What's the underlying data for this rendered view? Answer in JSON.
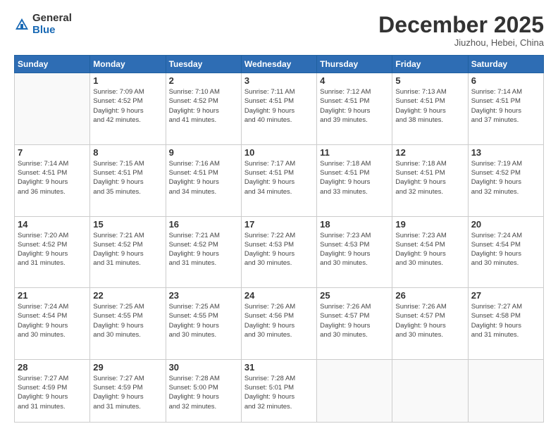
{
  "logo": {
    "general": "General",
    "blue": "Blue"
  },
  "title": "December 2025",
  "subtitle": "Jiuzhou, Hebei, China",
  "days_of_week": [
    "Sunday",
    "Monday",
    "Tuesday",
    "Wednesday",
    "Thursday",
    "Friday",
    "Saturday"
  ],
  "weeks": [
    [
      {
        "day": "",
        "info": ""
      },
      {
        "day": "1",
        "info": "Sunrise: 7:09 AM\nSunset: 4:52 PM\nDaylight: 9 hours\nand 42 minutes."
      },
      {
        "day": "2",
        "info": "Sunrise: 7:10 AM\nSunset: 4:52 PM\nDaylight: 9 hours\nand 41 minutes."
      },
      {
        "day": "3",
        "info": "Sunrise: 7:11 AM\nSunset: 4:51 PM\nDaylight: 9 hours\nand 40 minutes."
      },
      {
        "day": "4",
        "info": "Sunrise: 7:12 AM\nSunset: 4:51 PM\nDaylight: 9 hours\nand 39 minutes."
      },
      {
        "day": "5",
        "info": "Sunrise: 7:13 AM\nSunset: 4:51 PM\nDaylight: 9 hours\nand 38 minutes."
      },
      {
        "day": "6",
        "info": "Sunrise: 7:14 AM\nSunset: 4:51 PM\nDaylight: 9 hours\nand 37 minutes."
      }
    ],
    [
      {
        "day": "7",
        "info": "Sunrise: 7:14 AM\nSunset: 4:51 PM\nDaylight: 9 hours\nand 36 minutes."
      },
      {
        "day": "8",
        "info": "Sunrise: 7:15 AM\nSunset: 4:51 PM\nDaylight: 9 hours\nand 35 minutes."
      },
      {
        "day": "9",
        "info": "Sunrise: 7:16 AM\nSunset: 4:51 PM\nDaylight: 9 hours\nand 34 minutes."
      },
      {
        "day": "10",
        "info": "Sunrise: 7:17 AM\nSunset: 4:51 PM\nDaylight: 9 hours\nand 34 minutes."
      },
      {
        "day": "11",
        "info": "Sunrise: 7:18 AM\nSunset: 4:51 PM\nDaylight: 9 hours\nand 33 minutes."
      },
      {
        "day": "12",
        "info": "Sunrise: 7:18 AM\nSunset: 4:51 PM\nDaylight: 9 hours\nand 32 minutes."
      },
      {
        "day": "13",
        "info": "Sunrise: 7:19 AM\nSunset: 4:52 PM\nDaylight: 9 hours\nand 32 minutes."
      }
    ],
    [
      {
        "day": "14",
        "info": "Sunrise: 7:20 AM\nSunset: 4:52 PM\nDaylight: 9 hours\nand 31 minutes."
      },
      {
        "day": "15",
        "info": "Sunrise: 7:21 AM\nSunset: 4:52 PM\nDaylight: 9 hours\nand 31 minutes."
      },
      {
        "day": "16",
        "info": "Sunrise: 7:21 AM\nSunset: 4:52 PM\nDaylight: 9 hours\nand 31 minutes."
      },
      {
        "day": "17",
        "info": "Sunrise: 7:22 AM\nSunset: 4:53 PM\nDaylight: 9 hours\nand 30 minutes."
      },
      {
        "day": "18",
        "info": "Sunrise: 7:23 AM\nSunset: 4:53 PM\nDaylight: 9 hours\nand 30 minutes."
      },
      {
        "day": "19",
        "info": "Sunrise: 7:23 AM\nSunset: 4:54 PM\nDaylight: 9 hours\nand 30 minutes."
      },
      {
        "day": "20",
        "info": "Sunrise: 7:24 AM\nSunset: 4:54 PM\nDaylight: 9 hours\nand 30 minutes."
      }
    ],
    [
      {
        "day": "21",
        "info": "Sunrise: 7:24 AM\nSunset: 4:54 PM\nDaylight: 9 hours\nand 30 minutes."
      },
      {
        "day": "22",
        "info": "Sunrise: 7:25 AM\nSunset: 4:55 PM\nDaylight: 9 hours\nand 30 minutes."
      },
      {
        "day": "23",
        "info": "Sunrise: 7:25 AM\nSunset: 4:55 PM\nDaylight: 9 hours\nand 30 minutes."
      },
      {
        "day": "24",
        "info": "Sunrise: 7:26 AM\nSunset: 4:56 PM\nDaylight: 9 hours\nand 30 minutes."
      },
      {
        "day": "25",
        "info": "Sunrise: 7:26 AM\nSunset: 4:57 PM\nDaylight: 9 hours\nand 30 minutes."
      },
      {
        "day": "26",
        "info": "Sunrise: 7:26 AM\nSunset: 4:57 PM\nDaylight: 9 hours\nand 30 minutes."
      },
      {
        "day": "27",
        "info": "Sunrise: 7:27 AM\nSunset: 4:58 PM\nDaylight: 9 hours\nand 31 minutes."
      }
    ],
    [
      {
        "day": "28",
        "info": "Sunrise: 7:27 AM\nSunset: 4:59 PM\nDaylight: 9 hours\nand 31 minutes."
      },
      {
        "day": "29",
        "info": "Sunrise: 7:27 AM\nSunset: 4:59 PM\nDaylight: 9 hours\nand 31 minutes."
      },
      {
        "day": "30",
        "info": "Sunrise: 7:28 AM\nSunset: 5:00 PM\nDaylight: 9 hours\nand 32 minutes."
      },
      {
        "day": "31",
        "info": "Sunrise: 7:28 AM\nSunset: 5:01 PM\nDaylight: 9 hours\nand 32 minutes."
      },
      {
        "day": "",
        "info": ""
      },
      {
        "day": "",
        "info": ""
      },
      {
        "day": "",
        "info": ""
      }
    ]
  ]
}
